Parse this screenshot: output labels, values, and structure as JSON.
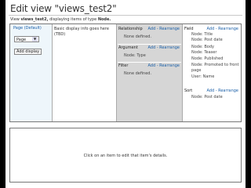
{
  "title": "Edit view \"views_test2\"",
  "subtitle": {
    "prefix": "View",
    "name": "views_test2,",
    "suffix": "displaying items of type",
    "type": "Node."
  },
  "display": {
    "tab": "Page (Default)",
    "select": "Page",
    "add_button": "Add display"
  },
  "basic": {
    "text": "Basic display info goes here (TBD)"
  },
  "middle": {
    "relationship": {
      "heading": "Relationship",
      "links": "Add - Rearrange",
      "empty": "None defined."
    },
    "argument": {
      "heading": "Argument",
      "links": "Add - Rearrange",
      "items": [
        "Node: Type"
      ]
    },
    "filter": {
      "heading": "Filter",
      "links": "Add - Rearrange",
      "empty": "None defined."
    }
  },
  "right": {
    "field": {
      "heading": "Field",
      "links": "Add - Rearrange",
      "items": [
        "Node: Title",
        "Node: Post date",
        "Node: Body",
        "Node: Teaser",
        "Node: Published",
        "Node: Promoted to front",
        "page",
        "User: Name"
      ]
    },
    "sort": {
      "heading": "Sort",
      "links": "Add - Rearrange",
      "items": [
        "Node: Post date"
      ]
    }
  },
  "details": {
    "text": "Click on an item to edit that item's details."
  }
}
